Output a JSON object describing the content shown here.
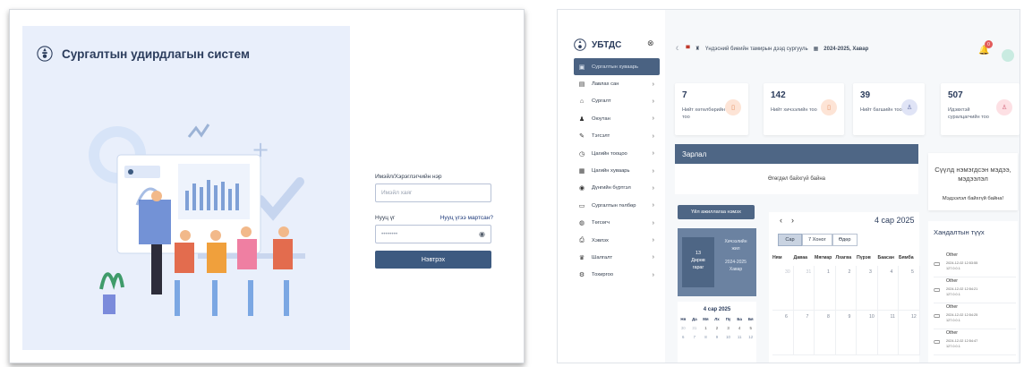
{
  "login": {
    "brand_title": "Сургалтын удирдлагын систем",
    "email_label": "Имэйл/Хэрэглэгчийн нэр",
    "email_placeholder": "Имэйл хаяг",
    "password_label": "Нууц үг",
    "forgot_link": "Нууц үгээ мартсан?",
    "password_value": "••••••••",
    "eye_icon": "eye-icon",
    "submit_label": "Нэвтрэх",
    "colors": {
      "panel_bg": "#e9effb",
      "accent": "#3d5a80"
    }
  },
  "dashboard": {
    "logo_text": "УБТДС",
    "collapse_icon": "⊗",
    "menu": [
      {
        "icon": "▣",
        "label": "Сургалтын хуваарь",
        "active": true
      },
      {
        "icon": "▤",
        "label": "Лавлах сан",
        "active": false
      },
      {
        "icon": "⌂",
        "label": "Сургалт",
        "active": false
      },
      {
        "icon": "♟",
        "label": "Оюутан",
        "active": false
      },
      {
        "icon": "✎",
        "label": "Тэгсэлт",
        "active": false
      },
      {
        "icon": "◷",
        "label": "Цагийн тооцоо",
        "active": false
      },
      {
        "icon": "▦",
        "label": "Цагийн хуваарь",
        "active": false
      },
      {
        "icon": "◉",
        "label": "Дүнгийн бүртгэл",
        "active": false
      },
      {
        "icon": "▭",
        "label": "Сургалтын төлбөр",
        "active": false
      },
      {
        "icon": "◍",
        "label": "Төгсөгч",
        "active": false
      },
      {
        "icon": "⎙",
        "label": "Хэвлэх",
        "active": false
      },
      {
        "icon": "♛",
        "label": "Шалгалт",
        "active": false
      },
      {
        "icon": "⚙",
        "label": "Тохиргоо",
        "active": false
      }
    ],
    "topbar": {
      "moon_icon": "☾",
      "flag_icon": "▀",
      "emblem_icon": "♜",
      "school_name": "Үндэсний биеийн тамирын дээд сургууль",
      "term_icon": "▦",
      "term": "2024-2025, Хавар"
    },
    "notifications": {
      "bell_icon": "🔔",
      "count": "0"
    },
    "stats": [
      {
        "value": "7",
        "label": "Нийт хөтөлбөрийн тоо",
        "icon": "▯",
        "icon_bg": "#fde4d6",
        "icon_color": "#e38a5a"
      },
      {
        "value": "142",
        "label": "Нийт хичээлийн тоо",
        "icon": "▯",
        "icon_bg": "#fde4d6",
        "icon_color": "#e38a5a"
      },
      {
        "value": "39",
        "label": "Нийт багшийн тоо",
        "icon": "♙",
        "icon_bg": "#e0e4f6",
        "icon_color": "#6774a8"
      },
      {
        "value": "507",
        "label": "Идэвхтэй суралцагчийн тоо",
        "icon": "♙",
        "icon_bg": "#fde0e4",
        "icon_color": "#d56b80"
      }
    ],
    "announcement": {
      "title": "Зарлал",
      "empty": "Өгөгдөл байхгүй байна"
    },
    "add_button": "Үйл ажиллагаа нэмэх",
    "date_card": {
      "left_lines": [
        "13",
        "Дөрөв",
        "гараг"
      ],
      "right_lines": [
        "Хичээлийн",
        "жил",
        "2024-2025",
        "Хавар"
      ]
    },
    "mini_calendar": {
      "title": "4 сар 2025",
      "weekdays": [
        "Ня",
        "Да",
        "Мя",
        "Лх",
        "Пү",
        "Ба",
        "Бя"
      ],
      "rows": [
        [
          "30",
          "31",
          "1",
          "2",
          "3",
          "4",
          "5"
        ],
        [
          "6",
          "7",
          "8",
          "9",
          "10",
          "11",
          "12"
        ]
      ]
    },
    "calendar": {
      "nav": "‹ ›",
      "month": "4 сар 2025",
      "views": [
        "Сар",
        "7 Хоног",
        "Өдөр"
      ],
      "weekdays": [
        "Ням",
        "Даваа",
        "Мягмар",
        "Лхагва",
        "Пүрэв",
        "Баасан",
        "Бямба"
      ],
      "rows": [
        [
          "30",
          "31",
          "1",
          "2",
          "3",
          "4",
          "5"
        ],
        [
          "6",
          "7",
          "8",
          "9",
          "10",
          "11",
          "12"
        ]
      ]
    },
    "side_note": {
      "title": "Сүүлд нэмэгдсэн мэдээ, мэдээлэл",
      "empty": "Мэдээлэл байхгүй байна!"
    },
    "access_history": {
      "title": "Хандалтын түүх",
      "monitor_icon": "▭",
      "entries": [
        {
          "title": "Other",
          "date": "2024-12-02 12:53:55",
          "ip": "127.0.0.1"
        },
        {
          "title": "Other",
          "date": "2024-12-02 12:54:21",
          "ip": "127.0.0.1"
        },
        {
          "title": "Other",
          "date": "2024-12-02 12:54:25",
          "ip": "127.0.0.1"
        },
        {
          "title": "Other",
          "date": "2024-12-02 12:54:47",
          "ip": "127.0.0.1"
        }
      ]
    }
  }
}
